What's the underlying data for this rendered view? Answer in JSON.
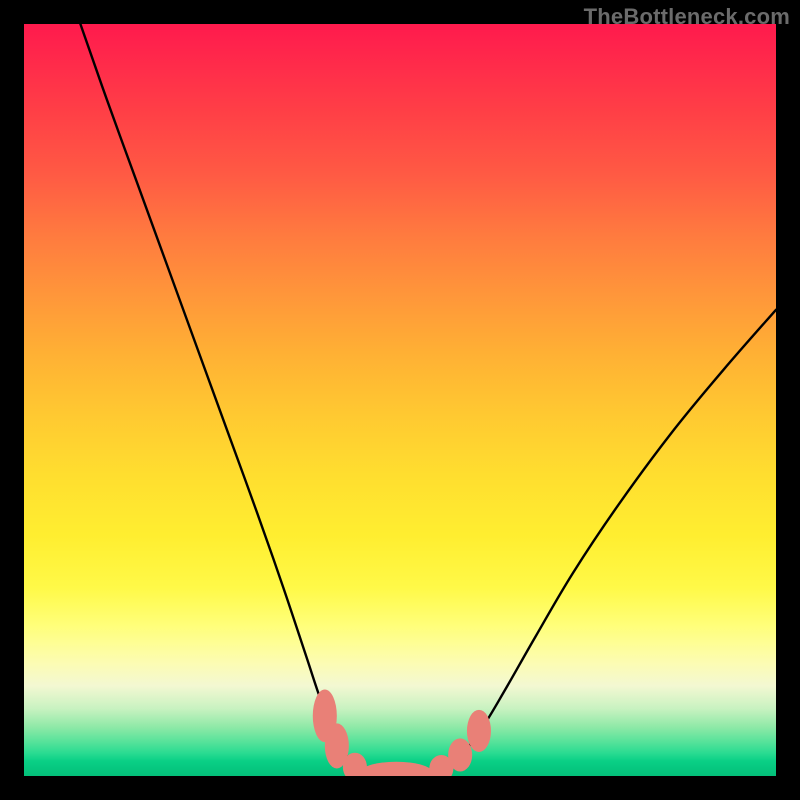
{
  "watermark": "TheBottleneck.com",
  "colors": {
    "curve": "#000000",
    "marker_fill": "#e98077",
    "marker_stroke": "#d46a63",
    "background_frame": "#000000"
  },
  "chart_data": {
    "type": "line",
    "title": "",
    "xlabel": "",
    "ylabel": "",
    "x_range": [
      0,
      100
    ],
    "y_range": [
      0,
      100
    ],
    "curve_points": [
      {
        "x": 7.5,
        "y": 100.0
      },
      {
        "x": 11.0,
        "y": 90.0
      },
      {
        "x": 15.0,
        "y": 79.0
      },
      {
        "x": 19.0,
        "y": 68.0
      },
      {
        "x": 23.0,
        "y": 57.0
      },
      {
        "x": 27.0,
        "y": 46.0
      },
      {
        "x": 31.0,
        "y": 35.0
      },
      {
        "x": 34.5,
        "y": 25.0
      },
      {
        "x": 37.5,
        "y": 16.0
      },
      {
        "x": 39.5,
        "y": 10.0
      },
      {
        "x": 41.5,
        "y": 5.0
      },
      {
        "x": 44.0,
        "y": 1.5
      },
      {
        "x": 47.0,
        "y": 0.4
      },
      {
        "x": 50.0,
        "y": 0.0
      },
      {
        "x": 53.0,
        "y": 0.3
      },
      {
        "x": 56.0,
        "y": 1.2
      },
      {
        "x": 58.5,
        "y": 3.2
      },
      {
        "x": 61.0,
        "y": 6.5
      },
      {
        "x": 64.0,
        "y": 11.5
      },
      {
        "x": 68.0,
        "y": 18.5
      },
      {
        "x": 73.0,
        "y": 27.0
      },
      {
        "x": 79.0,
        "y": 36.0
      },
      {
        "x": 86.0,
        "y": 45.5
      },
      {
        "x": 93.0,
        "y": 54.0
      },
      {
        "x": 100.0,
        "y": 62.0
      }
    ],
    "markers": [
      {
        "x": 40.0,
        "y": 8.0,
        "rx": 1.6,
        "ry": 3.5
      },
      {
        "x": 41.6,
        "y": 4.0,
        "rx": 1.6,
        "ry": 3.0
      },
      {
        "x": 44.0,
        "y": 1.2,
        "rx": 1.6,
        "ry": 1.9
      },
      {
        "x": 49.5,
        "y": 0.3,
        "rx": 5.0,
        "ry": 1.6
      },
      {
        "x": 55.5,
        "y": 1.0,
        "rx": 1.6,
        "ry": 1.8
      },
      {
        "x": 58.0,
        "y": 2.8,
        "rx": 1.6,
        "ry": 2.2
      },
      {
        "x": 60.5,
        "y": 6.0,
        "rx": 1.6,
        "ry": 2.8
      }
    ]
  }
}
